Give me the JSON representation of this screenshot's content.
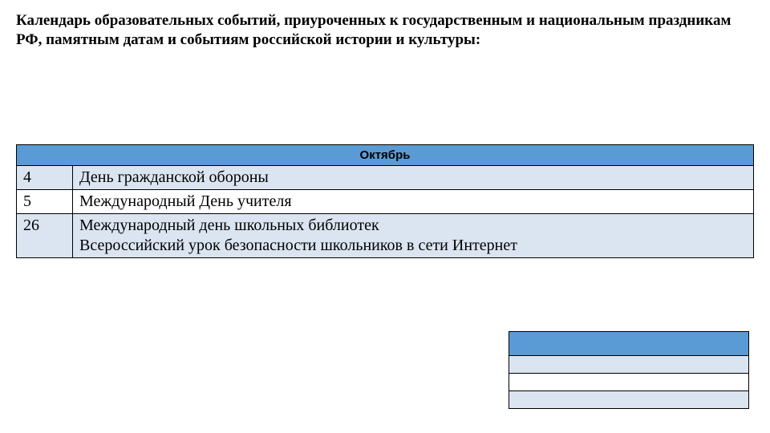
{
  "title": "Календарь образовательных событий, приуроченных к государственным и национальным праздникам РФ, памятным датам и событиям российской истории и культуры:",
  "month_header": "Октябрь",
  "rows": [
    {
      "day": "4",
      "event": "День гражданской обороны"
    },
    {
      "day": "5",
      "event": "Международный День учителя"
    },
    {
      "day": "26",
      "event": "Международный день школьных библиотек\nВсероссийский урок безопасности школьников в сети Интернет"
    }
  ]
}
